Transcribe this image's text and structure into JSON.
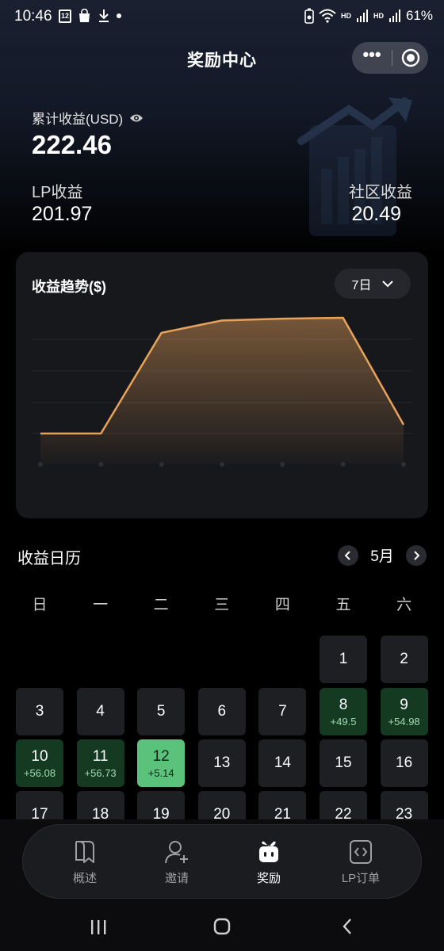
{
  "status_bar": {
    "time": "10:46",
    "calendar_badge": "12",
    "hd1": "HD",
    "hd2": "HD",
    "battery": "61%"
  },
  "title_bar": {
    "title": "奖励中心",
    "more_icon": "more-dots-icon",
    "close_icon": "record-circle-icon"
  },
  "earnings": {
    "cumulative_label": "累计收益(USD)",
    "cumulative_value": "222.46",
    "lp_label": "LP收益",
    "lp_value": "201.97",
    "community_label": "社区收益",
    "community_value": "20.49"
  },
  "trend": {
    "title": "收益趋势($)",
    "range": "7日"
  },
  "chart_data": {
    "type": "area",
    "title": "收益趋势($)",
    "xlabel": "",
    "ylabel": "",
    "values": [
      0,
      0,
      57,
      64,
      65,
      65.5,
      5
    ],
    "grid": true,
    "legend": "none"
  },
  "calendar": {
    "title": "收益日历",
    "month": "5月",
    "weekdays": [
      "日",
      "一",
      "二",
      "三",
      "四",
      "五",
      "六"
    ],
    "days": [
      {
        "n": "1",
        "e": "",
        "s": ""
      },
      {
        "n": "2",
        "e": "",
        "s": ""
      },
      {
        "n": "3",
        "e": "",
        "s": ""
      },
      {
        "n": "4",
        "e": "",
        "s": ""
      },
      {
        "n": "5",
        "e": "",
        "s": ""
      },
      {
        "n": "6",
        "e": "",
        "s": ""
      },
      {
        "n": "7",
        "e": "",
        "s": ""
      },
      {
        "n": "8",
        "e": "+49.5",
        "s": "pos"
      },
      {
        "n": "9",
        "e": "+54.98",
        "s": "pos"
      },
      {
        "n": "10",
        "e": "+56.08",
        "s": "pos"
      },
      {
        "n": "11",
        "e": "+56.73",
        "s": "pos"
      },
      {
        "n": "12",
        "e": "+5.14",
        "s": "today"
      },
      {
        "n": "13",
        "e": "",
        "s": ""
      },
      {
        "n": "14",
        "e": "",
        "s": ""
      },
      {
        "n": "15",
        "e": "",
        "s": ""
      },
      {
        "n": "16",
        "e": "",
        "s": ""
      },
      {
        "n": "17",
        "e": "",
        "s": ""
      },
      {
        "n": "18",
        "e": "",
        "s": ""
      },
      {
        "n": "19",
        "e": "",
        "s": ""
      },
      {
        "n": "20",
        "e": "",
        "s": ""
      },
      {
        "n": "21",
        "e": "",
        "s": ""
      },
      {
        "n": "22",
        "e": "",
        "s": ""
      },
      {
        "n": "23",
        "e": "",
        "s": ""
      }
    ]
  },
  "tabs": [
    {
      "label": "概述",
      "icon": "book-icon"
    },
    {
      "label": "邀请",
      "icon": "add-user-icon"
    },
    {
      "label": "奖励",
      "icon": "gift-icon"
    },
    {
      "label": "LP订单",
      "icon": "code-file-icon"
    }
  ],
  "colors": {
    "accent_line": "#e8a25a",
    "positive_day": "#143a22",
    "today": "#5ac27a"
  }
}
